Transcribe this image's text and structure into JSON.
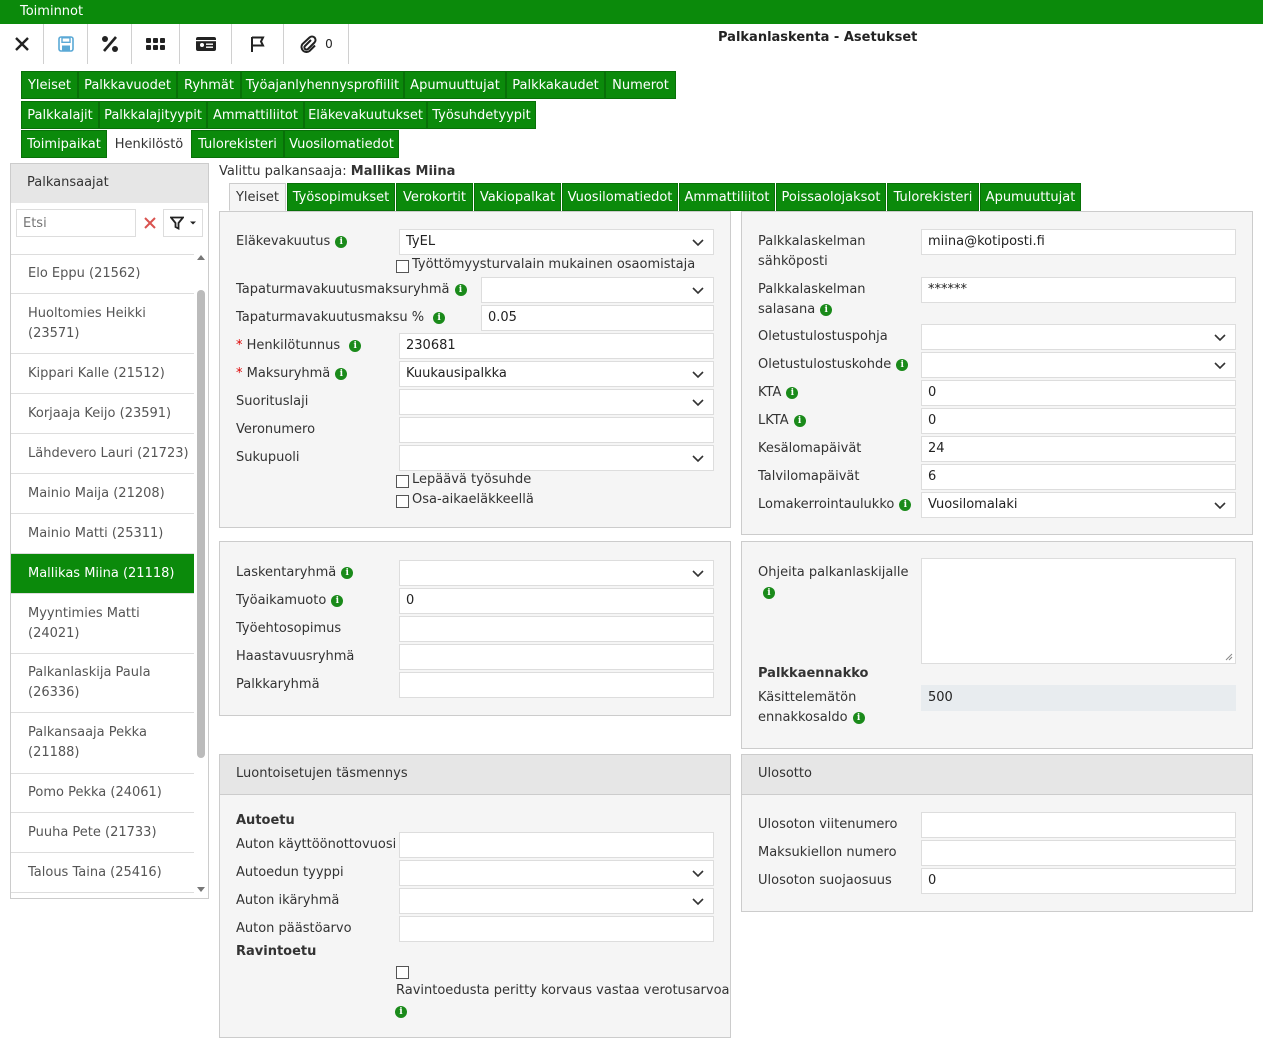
{
  "menubar": {
    "label": "Toiminnot"
  },
  "toolbar": {
    "attachment_count": "0",
    "title": "Palkanlaskenta - Asetukset"
  },
  "top_tabs": [
    [
      "Yleiset",
      "Palkkavuodet",
      "Ryhmät",
      "Työajanlyhennysprofiilit",
      "Apumuuttujat",
      "Palkkakaudet",
      "Numerot"
    ],
    [
      "Palkkalajit",
      "Palkkalajityypit",
      "Ammattiliitot",
      "Eläkevakuutukset",
      "Työsuhdetyypit"
    ],
    [
      "Toimipaikat",
      "Henkilöstö",
      "Tulorekisteri",
      "Vuosilomatiedot"
    ]
  ],
  "sidebar": {
    "title": "Palkansaajat",
    "search_placeholder": "Etsi",
    "items": [
      {
        "line1": "Elo Eppu (21562)",
        "line2": ""
      },
      {
        "line1": "Huoltomies Heikki",
        "line2": "(23571)"
      },
      {
        "line1": "Kippari Kalle (21512)",
        "line2": ""
      },
      {
        "line1": "Korjaaja Keijo (23591)",
        "line2": ""
      },
      {
        "line1": "Lähdevero Lauri (21723)",
        "line2": ""
      },
      {
        "line1": "Mainio Maija (21208)",
        "line2": ""
      },
      {
        "line1": "Mainio Matti (25311)",
        "line2": ""
      },
      {
        "line1": "Mallikas Miina (21118)",
        "line2": ""
      },
      {
        "line1": "Myyntimies Matti",
        "line2": "(24021)"
      },
      {
        "line1": "Palkanlaskija Paula",
        "line2": "(26336)"
      },
      {
        "line1": "Palkansaaja Pekka",
        "line2": "(21188)"
      },
      {
        "line1": "Pomo Pekka (24061)",
        "line2": ""
      },
      {
        "line1": "Puuha Pete (21733)",
        "line2": ""
      },
      {
        "line1": "Talous Taina (25416)",
        "line2": ""
      }
    ]
  },
  "selected": {
    "label": "Valittu palkansaaja:",
    "name": "Mallikas Miina"
  },
  "sub_tabs": [
    "Yleiset",
    "Työsopimukset",
    "Verokortit",
    "Vakiopalkat",
    "Vuosilomatiedot",
    "Ammattiliitot",
    "Poissaolojaksot",
    "Tulorekisteri",
    "Apumuuttujat"
  ],
  "basic": {
    "elakevakuutus_label": "Eläkevakuutus",
    "elakevakuutus_value": "TyEL",
    "tyottomyys_label": "Työttömyysturvalain mukainen osaomistaja",
    "tapaturmaryhma_label": "Tapaturmavakuutusmaksuryhmä",
    "tapaturmaryhma_value": "",
    "tapaturmamaksu_label": "Tapaturmavakuutusmaksu %",
    "tapaturmamaksu_value": "0.05",
    "required_mark": "*",
    "hetu_label": "Henkilötunnus",
    "hetu_value": "230681",
    "maksuryhma_label": "Maksuryhmä",
    "maksuryhma_value": "Kuukausipalkka",
    "suorituslaji_label": "Suorituslaji",
    "suorituslaji_value": "",
    "veronumero_label": "Veronumero",
    "veronumero_value": "",
    "sukupuoli_label": "Sukupuoli",
    "sukupuoli_value": "",
    "lepaava_label": "Lepäävä työsuhde",
    "osaaika_label": "Osa-aikaeläkkeellä"
  },
  "contact": {
    "email_label_1": "Palkkalaskelman",
    "email_label_2": "sähköposti",
    "email_value": "miina@kotiposti.fi",
    "password_label_1": "Palkkalaskelman",
    "password_label_2": "salasana",
    "password_value": "******",
    "pohja_label": "Oletustulostuspohja",
    "pohja_value": "",
    "kohde_label": "Oletustulostuskohde",
    "kohde_value": "",
    "kta_label": "KTA",
    "kta_value": "0",
    "lkta_label": "LKTA",
    "lkta_value": "0",
    "kesa_label": "Kesälomapäivät",
    "kesa_value": "24",
    "talvi_label": "Talvilomapäivät",
    "talvi_value": "6",
    "lomak_label": "Lomakerrointaulukko",
    "lomak_value": "Vuosilomalaki"
  },
  "groups": {
    "laskenta_label": "Laskentaryhmä",
    "laskenta_value": "",
    "tyoaika_label": "Työaikamuoto",
    "tyoaika_value": "0",
    "tes_label": "Työehtosopimus",
    "tes_value": "",
    "haasta_label": "Haastavuusryhmä",
    "haasta_value": "",
    "palkka_label": "Palkkaryhmä",
    "palkka_value": ""
  },
  "notes": {
    "ohjeita_label": "Ohjeita palkanlaskijalle",
    "ennakko_title": "Palkkaennakko",
    "kasittelematon_1": "Käsittelemätön",
    "kasittelematon_2": "ennakkosaldo",
    "kasittelematon_value": "500"
  },
  "fringe": {
    "title": "Luontoisetujen täsmennys",
    "autoetu": "Autoetu",
    "vuosi_label": "Auton käyttöönottovuosi",
    "vuosi_value": "",
    "tyyppi_label": "Autoedun tyyppi",
    "tyyppi_value": "",
    "ika_label": "Auton ikäryhmä",
    "ika_value": "",
    "paasto_label": "Auton päästöarvo",
    "paasto_value": "",
    "ravinto": "Ravintoetu",
    "ravinto_cb_label": "Ravintoedusta peritty korvaus vastaa verotusarvoa"
  },
  "ulosotto": {
    "title": "Ulosotto",
    "viite_label": "Ulosoton viitenumero",
    "viite_value": "",
    "kielto_label": "Maksukiellon numero",
    "kielto_value": "",
    "suoja_label": "Ulosoton suojaosuus",
    "suoja_value": "0"
  },
  "icons": {
    "info": "i"
  },
  "colors": {
    "brand": "#0b8a0b",
    "required": "#dd0000"
  }
}
